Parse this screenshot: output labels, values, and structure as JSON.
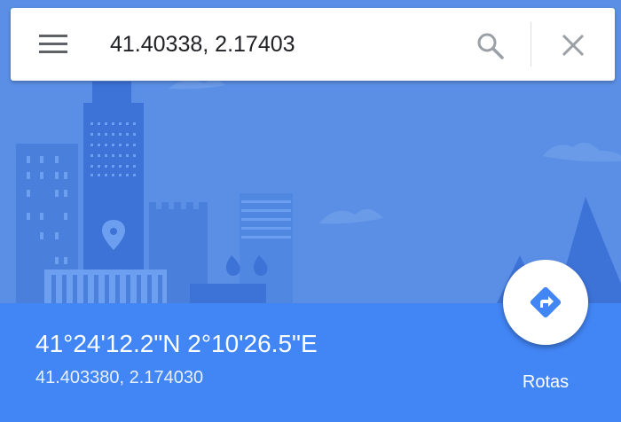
{
  "search": {
    "value": "41.40338, 2.17403",
    "menu_icon": "hamburger-menu-icon",
    "search_icon": "search-icon",
    "close_icon": "close-icon"
  },
  "place": {
    "dms": "41°24'12.2\"N 2°10'26.5\"E",
    "decimal": "41.403380, 2.174030"
  },
  "directions": {
    "label": "Rotas",
    "icon": "directions-arrow-icon"
  },
  "colors": {
    "primary": "#4285f4",
    "sky": "#5b8fe6",
    "building": "#3d72d6",
    "white": "#ffffff"
  }
}
